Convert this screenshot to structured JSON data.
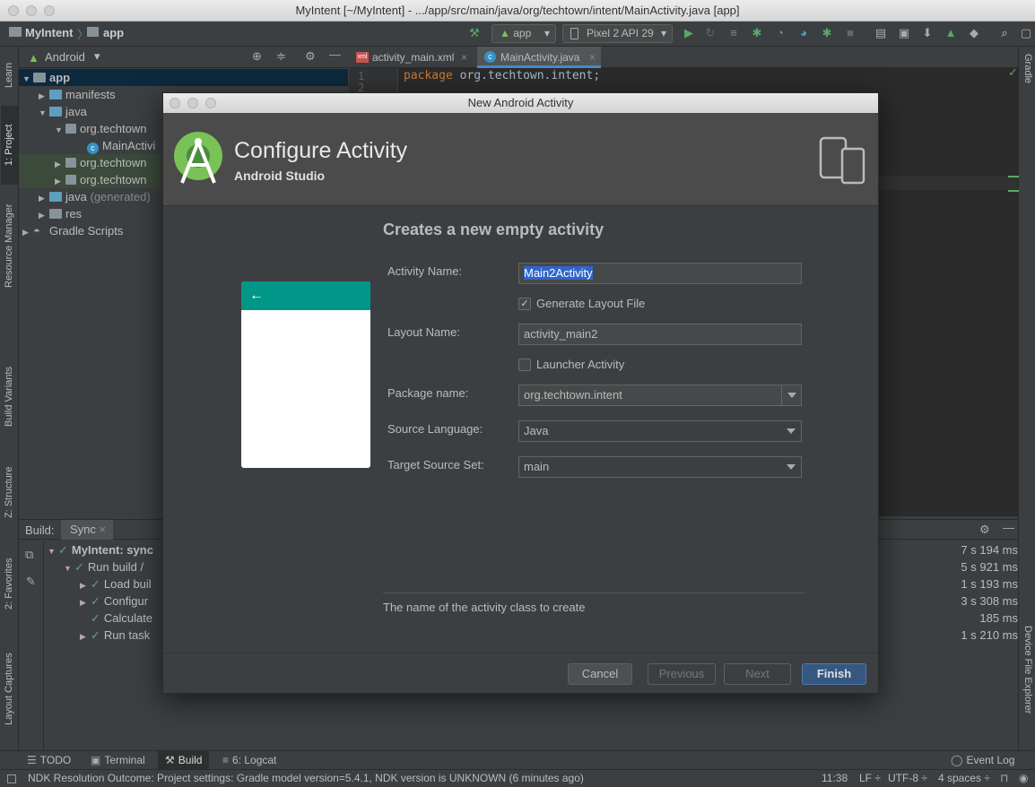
{
  "window": {
    "title": "MyIntent [~/MyIntent] - .../app/src/main/java/org/techtown/intent/MainActivity.java [app]"
  },
  "navbar": {
    "project": "MyIntent",
    "module": "app",
    "run_config": "app",
    "device": "Pixel 2 API 29"
  },
  "project_panel": {
    "view_mode": "Android",
    "tree": [
      {
        "label": "app",
        "level": 0
      },
      {
        "label": "manifests",
        "level": 1
      },
      {
        "label": "java",
        "level": 1
      },
      {
        "label": "org.techtown",
        "level": 2
      },
      {
        "label": "MainActivi",
        "level": 3
      },
      {
        "label": "org.techtown",
        "level": 2
      },
      {
        "label": "org.techtown",
        "level": 2
      },
      {
        "label": "java",
        "suffix": "(generated)",
        "level": 1
      },
      {
        "label": "res",
        "level": 1
      },
      {
        "label": "Gradle Scripts",
        "level": 0
      }
    ]
  },
  "editor": {
    "tabs": [
      {
        "label": "activity_main.xml"
      },
      {
        "label": "MainActivity.java"
      }
    ],
    "line_numbers": [
      "1",
      "2"
    ],
    "code_keyword": "package",
    "code_rest": " org.techtown.intent;"
  },
  "left_toolbar": [
    "1: Project",
    "Learn",
    "Resource Manager",
    "Build Variants",
    "Z: Structure",
    "2: Favorites",
    "Layout Captures"
  ],
  "right_toolbar": [
    "Gradle",
    "Device File Explorer"
  ],
  "build_panel": {
    "label": "Build:",
    "tab": "Sync",
    "rows": [
      {
        "label": "MyIntent: sync",
        "time": "7 s 194 ms",
        "level": 0
      },
      {
        "label": "Run build /",
        "time": "5 s 921 ms",
        "level": 1
      },
      {
        "label": "Load buil",
        "time": "1 s 193 ms",
        "level": 2
      },
      {
        "label": "Configur",
        "time": "3 s 308 ms",
        "level": 2
      },
      {
        "label": "Calculate",
        "time": "185 ms",
        "level": 2
      },
      {
        "label": "Run task",
        "time": "1 s 210 ms",
        "level": 2
      }
    ]
  },
  "bottom_tabs": {
    "todo": "TODO",
    "terminal": "Terminal",
    "build": "Build",
    "logcat": "6: Logcat",
    "event_log": "Event Log"
  },
  "status_bar": {
    "message": "NDK Resolution Outcome: Project settings: Gradle model version=5.4.1, NDK version is UNKNOWN (6 minutes ago)",
    "position": "11:38",
    "line_sep": "LF ÷",
    "encoding": "UTF-8 ÷",
    "indent": "4 spaces ÷"
  },
  "dialog": {
    "window_title": "New Android Activity",
    "header_title": "Configure Activity",
    "header_subtitle": "Android Studio",
    "subtitle": "Creates a new empty activity",
    "fields": {
      "activity_name_label": "Activity Name:",
      "activity_name_value": "Main2Activity",
      "generate_layout_label": "Generate Layout File",
      "generate_layout_checked": true,
      "layout_name_label": "Layout Name:",
      "layout_name_value": "activity_main2",
      "launcher_label": "Launcher Activity",
      "launcher_checked": false,
      "package_label": "Package name:",
      "package_value": "org.techtown.intent",
      "source_lang_label": "Source Language:",
      "source_lang_value": "Java",
      "target_set_label": "Target Source Set:",
      "target_set_value": "main"
    },
    "help_text": "The name of the activity class to create",
    "buttons": {
      "cancel": "Cancel",
      "previous": "Previous",
      "next": "Next",
      "finish": "Finish"
    },
    "accent": "#009688",
    "finish_color": "#365880"
  }
}
